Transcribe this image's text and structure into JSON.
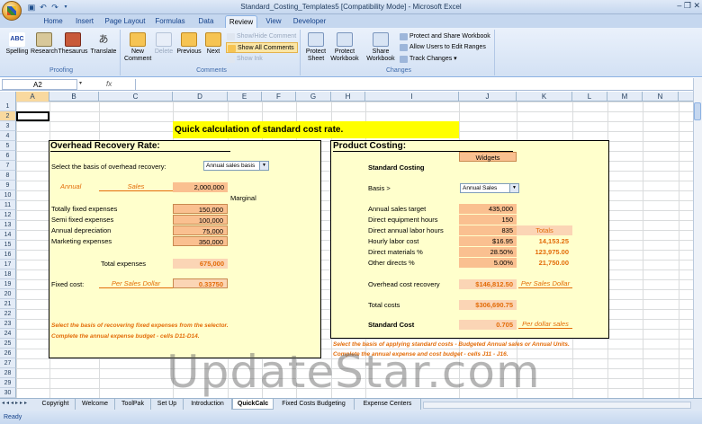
{
  "window": {
    "title": "Standard_Costing_Templates5  [Compatibility Mode]  -  Microsoft Excel"
  },
  "tabs": [
    "Home",
    "Insert",
    "Page Layout",
    "Formulas",
    "Data",
    "Review",
    "View",
    "Developer"
  ],
  "ribbon": {
    "proofing": {
      "label": "Proofing",
      "buttons": [
        "Spelling",
        "Research",
        "Thesaurus",
        "Translate"
      ]
    },
    "comments": {
      "label": "Comments",
      "new": "New Comment",
      "delete": "Delete",
      "previous": "Previous",
      "next": "Next",
      "show_hide": "Show/Hide Comment",
      "show_all": "Show All Comments",
      "show_ink": "Show Ink"
    },
    "changes": {
      "label": "Changes",
      "protect_sheet": "Protect Sheet",
      "protect_workbook": "Protect Workbook",
      "share_workbook": "Share Workbook",
      "protect_share": "Protect and Share Workbook",
      "allow_users": "Allow Users to Edit Ranges",
      "track_changes": "Track Changes"
    }
  },
  "formula_bar": {
    "name_box": "A2",
    "fx": "fx",
    "formula": ""
  },
  "columns": [
    "A",
    "B",
    "C",
    "D",
    "E",
    "F",
    "G",
    "H",
    "I",
    "J",
    "K",
    "L",
    "M",
    "N"
  ],
  "rows": [
    "1",
    "2",
    "3",
    "4",
    "5",
    "6",
    "7",
    "8",
    "9",
    "10",
    "11",
    "12",
    "13",
    "14",
    "15",
    "16",
    "17",
    "18",
    "19",
    "20",
    "21",
    "22",
    "23",
    "24",
    "25",
    "26",
    "27",
    "28",
    "29",
    "30"
  ],
  "sheet": {
    "title": "Quick calculation of standard cost rate.",
    "overhead": {
      "heading": "Overhead Recovery Rate:",
      "select_label": "Select the basis of overhead recovery:",
      "select_value": "Annual sales basis",
      "annual_label": "Annual",
      "sales_label": "Sales",
      "sales_value": "2,000,000",
      "marginal": "Marginal",
      "rows": [
        {
          "label": "Totally fixed expenses",
          "value": "150,000"
        },
        {
          "label": "Semi fixed expenses",
          "value": "100,000"
        },
        {
          "label": "Annual depreciation",
          "value": "75,000"
        },
        {
          "label": "Marketing expenses",
          "value": "350,000"
        }
      ],
      "total_label": "Total expenses",
      "total_value": "675,000",
      "fixed_label": "Fixed cost:",
      "per_label": "Per Sales Dollar",
      "fixed_value": "0.33750",
      "note1": "Select the basis of recovering fixed expenses from the selector.",
      "note2": "Complete the annual expense budget - cells D11-D14."
    },
    "product": {
      "heading": "Product Costing:",
      "widget": "Widgets",
      "std_costing": "Standard Costing",
      "basis_label": "Basis  >",
      "basis_value": "Annual Sales",
      "rows": [
        {
          "label": "Annual sales target",
          "value": "435,000",
          "total": ""
        },
        {
          "label": "Direct equipment hours",
          "value": "150",
          "total": ""
        },
        {
          "label": "Direct annual labor hours",
          "value": "835",
          "total": "Totals"
        },
        {
          "label": "Hourly labor cost",
          "value": "$16.95",
          "total": "14,153.25"
        },
        {
          "label": "Direct materials %",
          "value": "28.50%",
          "total": "123,975.00"
        },
        {
          "label": "Other directs %",
          "value": "5.00%",
          "total": "21,750.00"
        }
      ],
      "overhead_label": "Overhead cost recovery",
      "overhead_value": "$146,812.50",
      "overhead_per": "Per Sales Dollar",
      "total_costs_label": "Total costs",
      "total_costs_value": "$306,690.75",
      "std_cost_label": "Standard Cost",
      "std_cost_value": "0.705",
      "std_cost_per": "Per dollar sales",
      "note1": "Select the basis of applying standard costs - Budgeted Annual sales or Annual Units.",
      "note2": "Complete the annual expense and cost budget - cells J11 - J16."
    }
  },
  "sheet_tabs": [
    "Copyright",
    "Welcome",
    "ToolPak",
    "Set Up",
    "Introduction",
    "QuickCalc",
    "Fixed Costs Budgeting",
    "Expense Centers"
  ],
  "active_sheet_tab": "QuickCalc",
  "status": "Ready",
  "watermark": "UpdateStar.com"
}
